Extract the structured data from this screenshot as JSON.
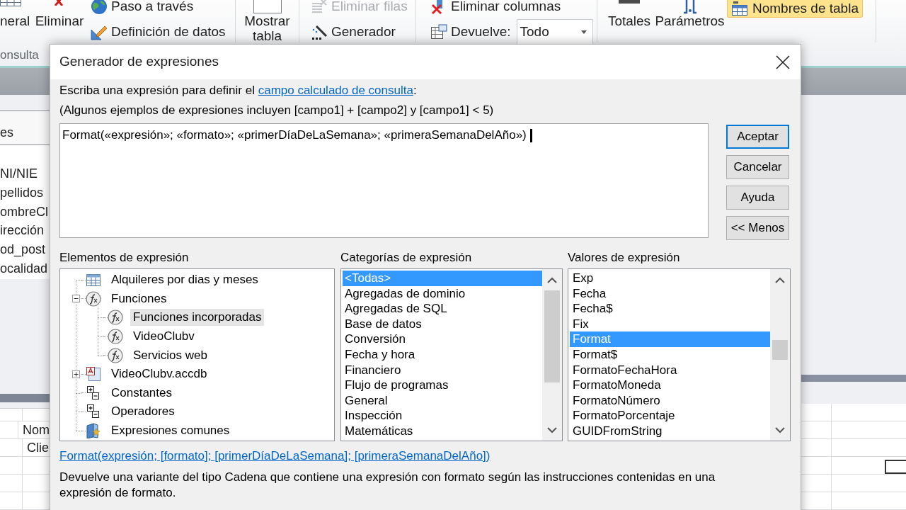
{
  "ribbon": {
    "large_left": [
      {
        "label": "neral"
      },
      {
        "label": "Eliminar"
      }
    ],
    "query_tools": [
      {
        "label": "Paso a través",
        "disabled": false
      },
      {
        "label": "Definición de datos",
        "disabled": false
      }
    ],
    "show_table": {
      "label": "Mostrar tabla"
    },
    "row_tools": [
      {
        "label": "Eliminar filas",
        "disabled": true
      },
      {
        "label": "Generador",
        "disabled": false
      }
    ],
    "delete_columns": {
      "label": "Eliminar columnas",
      "disabled": false
    },
    "returns": {
      "label": "Devuelve:",
      "value": "Todo"
    },
    "large_right": [
      {
        "label": "Totales"
      },
      {
        "label": "Parámetros"
      }
    ],
    "table_names": {
      "label": "Nombres de tabla",
      "on": true
    },
    "group_label": "onsulta"
  },
  "field_list": {
    "title": "es",
    "fields": [
      "NI/NIE",
      "pellidos",
      "ombreCl",
      "irección",
      "od_post",
      "ocalidad"
    ]
  },
  "query_grid": {
    "cells": [
      "Nom",
      "Clie"
    ],
    "checkbox": {
      "checked": false
    }
  },
  "dialog": {
    "title": "Generador de expresiones",
    "prompt": {
      "text": "Escriba una expresión para definir el ",
      "link": "campo calculado de consulta",
      "end": ":"
    },
    "examples": "(Algunos ejemplos de expresiones incluyen [campo1] + [campo2] y [campo1] < 5)",
    "expression": "Format(«expresión»; «formato»; «primerDíaDeLaSemana»; «primeraSemanaDelAño»)",
    "buttons": [
      {
        "label": "Aceptar",
        "default": true
      },
      {
        "label": "Cancelar",
        "default": false
      },
      {
        "label": "Ayuda",
        "default": false
      },
      {
        "label": "<< Menos",
        "default": false
      }
    ],
    "elements": {
      "label": "Elementos de expresión",
      "tree": [
        {
          "label": "Alquileres por dias y meses",
          "kind": "query",
          "selected": false
        },
        {
          "label": "Funciones",
          "kind": "functions",
          "selected": false,
          "expanded": true,
          "children": [
            {
              "label": "Funciones incorporadas",
              "kind": "function",
              "selected": true
            },
            {
              "label": "VideoClubv",
              "kind": "function",
              "selected": false
            },
            {
              "label": "Servicios web",
              "kind": "function",
              "selected": false
            }
          ]
        },
        {
          "label": "VideoClubv.accdb",
          "kind": "database",
          "selected": false,
          "expanded": false
        },
        {
          "label": "Constantes",
          "kind": "constants",
          "selected": false
        },
        {
          "label": "Operadores",
          "kind": "operators",
          "selected": false
        },
        {
          "label": "Expresiones comunes",
          "kind": "common",
          "selected": false
        }
      ]
    },
    "categories": {
      "label": "Categorías de expresión",
      "items": [
        {
          "label": "<Todas>",
          "selected": true
        },
        {
          "label": "Agregadas de dominio",
          "selected": false
        },
        {
          "label": "Agregadas de SQL",
          "selected": false
        },
        {
          "label": "Base de datos",
          "selected": false
        },
        {
          "label": "Conversión",
          "selected": false
        },
        {
          "label": "Fecha y hora",
          "selected": false
        },
        {
          "label": "Financiero",
          "selected": false
        },
        {
          "label": "Flujo de programas",
          "selected": false
        },
        {
          "label": "General",
          "selected": false
        },
        {
          "label": "Inspección",
          "selected": false
        },
        {
          "label": "Matemáticas",
          "selected": false
        }
      ]
    },
    "values": {
      "label": "Valores de expresión",
      "items": [
        {
          "label": "Exp",
          "selected": false
        },
        {
          "label": "Fecha",
          "selected": false
        },
        {
          "label": "Fecha$",
          "selected": false
        },
        {
          "label": "Fix",
          "selected": false
        },
        {
          "label": "Format",
          "selected": true
        },
        {
          "label": "Format$",
          "selected": false
        },
        {
          "label": "FormatoFechaHora",
          "selected": false
        },
        {
          "label": "FormatoMoneda",
          "selected": false
        },
        {
          "label": "FormatoNúmero",
          "selected": false
        },
        {
          "label": "FormatoPorcentaje",
          "selected": false
        },
        {
          "label": "GUIDFromString",
          "selected": false
        }
      ]
    },
    "syntax": "Format(expresión; [formato]; [primerDíaDeLaSemana]; [primeraSemanaDelAño])",
    "description": "Devuelve una variante del tipo Cadena que contiene una expresión con formato según las instrucciones contenidas en una expresión de formato."
  }
}
